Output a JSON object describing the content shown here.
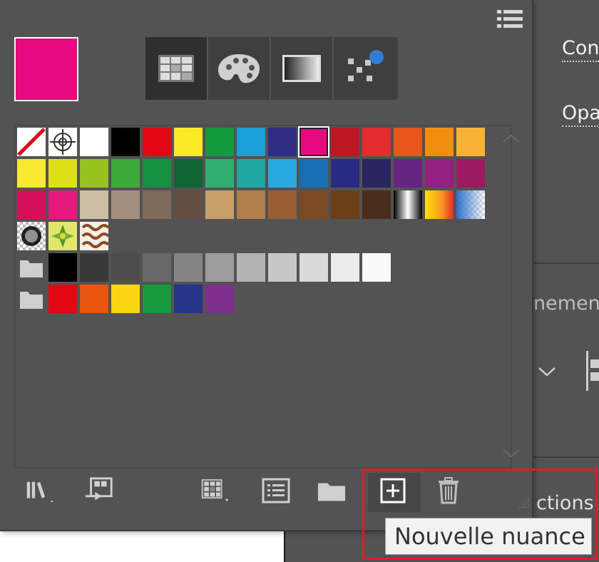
{
  "right_panel": {
    "label1": "Con",
    "label2": "Opa",
    "label3": "nement",
    "label4": "ctions"
  },
  "fill_color": "#e6097f",
  "view_buttons": [
    {
      "name": "list-view-small-icon"
    },
    {
      "name": "color-groups-palette-icon"
    },
    {
      "name": "gradient-view-icon"
    },
    {
      "name": "pattern-view-icon"
    }
  ],
  "swatch_rows": [
    [
      "none",
      "registration",
      "#ffffff",
      "#000000",
      "#e30613",
      "#fbe925",
      "#129a3c",
      "#1ca0dc",
      "#2f2c83",
      "#e6097f",
      "#be1622",
      "#e52d2f",
      "#e9561b",
      "#f18e0f",
      "#f8b235"
    ],
    [
      "#f6e930",
      "#dde017",
      "#98c21f",
      "#3caa37",
      "#169041",
      "#0f6533",
      "#2eae6f",
      "#1ea69f",
      "#28aae1",
      "#1770b6",
      "#292b82",
      "#2b2562",
      "#652581",
      "#922182",
      "#9c1a5f"
    ],
    [
      "#d60f5a",
      "#e51a7c",
      "#ccbea4",
      "#a48e80",
      "#7e6b5c",
      "#634e44",
      "#c89e69",
      "#b07f4a",
      "#975f33",
      "#7d4925",
      "#6b3f17",
      "#4a2d1a",
      "grad-bw",
      "grad-orange",
      "grad-blue"
    ],
    [
      "pat-dots",
      "pat-leaf",
      "pat-swirl"
    ]
  ],
  "gray_group": [
    "#000000",
    "#383838",
    "#4d4d4d",
    "#686868",
    "#848484",
    "#9c9c9c",
    "#b3b3b3",
    "#c7c7c7",
    "#dadada",
    "#ececec",
    "#fafafa"
  ],
  "color_group": [
    "#e30613",
    "#e9550f",
    "#fcd613",
    "#159a3d",
    "#273589",
    "#7d2f8e"
  ],
  "bottom_icons": [
    "swatch-libraries-icon",
    "place-swatches-icon",
    "swatch-kinds-icon",
    "swatch-options-icon",
    "new-color-group-icon",
    "new-swatch-icon",
    "delete-swatch-icon"
  ],
  "tooltip": "Nouvelle nuance"
}
